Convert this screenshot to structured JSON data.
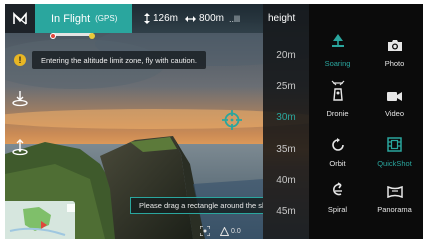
{
  "app": {
    "flight_mode": "In Flight",
    "flight_mode_sub": "(GPS)",
    "altitude": "126m",
    "distance": "800m",
    "signal_label": "..lll"
  },
  "warning": {
    "text": "Entering the altitude limit zone, fly with caution."
  },
  "hint": {
    "text": "Please drag a rectangle around the sh"
  },
  "bottom": {
    "reading": "0.0"
  },
  "height_panel": {
    "title": "height",
    "options": [
      "20m",
      "25m",
      "30m",
      "35m",
      "40m",
      "45m"
    ],
    "selected": "30m"
  },
  "modes": {
    "soaring": "Soaring",
    "dronie": "Dronie",
    "orbit": "Orbit",
    "spiral": "Spiral",
    "photo": "Photo",
    "video": "Video",
    "quickshot": "QuickShot",
    "panorama": "Panorama"
  },
  "colors": {
    "accent": "#2aa69e",
    "warning": "#e8b623",
    "panel_bg": "#0b0b0b"
  },
  "icons": {
    "logo": "app-logo-icon",
    "takeoff": "takeoff-icon",
    "land": "land-icon",
    "target": "target-crosshair-icon",
    "warning": "warning-icon"
  }
}
